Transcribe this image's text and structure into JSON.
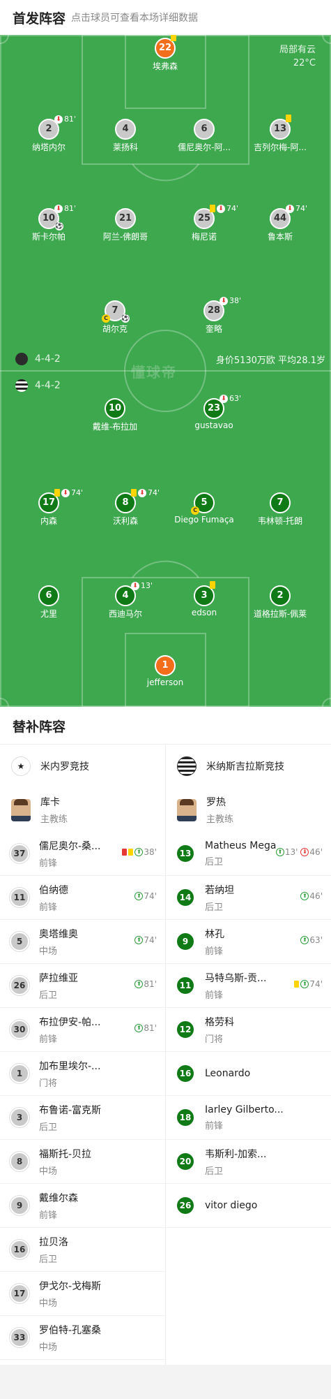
{
  "header": {
    "title": "首发阵容",
    "subtitle": "点击球员可查看本场详细数据"
  },
  "pitch": {
    "weather": [
      "局部有云",
      "22°C"
    ],
    "watermark": "懂球帝",
    "away_formation": "4-4-2",
    "home_formation": "4-4-2",
    "squad_value": "身价5130万欧 平均28.1岁"
  },
  "away_lineup": [
    {
      "num": "22",
      "name": "埃弗森",
      "gk": true,
      "ev": "yc"
    },
    {
      "num": "2",
      "name": "纳塔内尔",
      "ev": "sub",
      "min": "81'"
    },
    {
      "num": "4",
      "name": "莱扬科"
    },
    {
      "num": "6",
      "name": "儒尼奥尔-阿..."
    },
    {
      "num": "13",
      "name": "吉列尔梅-阿...",
      "ev": "yc"
    },
    {
      "num": "10",
      "name": "斯卡尔帕",
      "ev": "sub",
      "min": "81'",
      "ball": true
    },
    {
      "num": "21",
      "name": "阿兰-佛朗哥"
    },
    {
      "num": "25",
      "name": "梅尼诺",
      "ev": "yc-sub",
      "min": "74'"
    },
    {
      "num": "44",
      "name": "鲁本斯",
      "ev": "sub",
      "min": "74'"
    },
    {
      "num": "7",
      "name": "胡尔克",
      "cap": true,
      "ball": true
    },
    {
      "num": "28",
      "name": "奎略",
      "ev": "sub",
      "min": "38'"
    }
  ],
  "home_lineup": [
    {
      "num": "10",
      "name": "戴维-布拉加"
    },
    {
      "num": "23",
      "name": "gustavao",
      "ev": "sub",
      "min": "63'"
    },
    {
      "num": "17",
      "name": "内森",
      "ev": "yc-sub",
      "min": "74'"
    },
    {
      "num": "8",
      "name": "沃利森",
      "ev": "yc-sub",
      "min": "74'"
    },
    {
      "num": "5",
      "name": "Diego Fumaça",
      "cap": true
    },
    {
      "num": "7",
      "name": "韦林顿-托朗"
    },
    {
      "num": "6",
      "name": "尤里"
    },
    {
      "num": "4",
      "name": "西迪马尔",
      "ev": "sub",
      "min": "13'"
    },
    {
      "num": "3",
      "name": "edson",
      "ev": "yc"
    },
    {
      "num": "2",
      "name": "道格拉斯-佩莱"
    },
    {
      "num": "1",
      "name": "jefferson",
      "gk": true
    }
  ],
  "subs": {
    "title": "替补阵容",
    "left": {
      "team": "米内罗竞技",
      "coach": {
        "name": "库卡",
        "role": "主教练"
      },
      "players": [
        {
          "num": "37",
          "name": "儒尼奥尔-桑...",
          "pos": "前锋",
          "card": "ry",
          "in": "38'"
        },
        {
          "num": "11",
          "name": "伯纳德",
          "pos": "前锋",
          "in": "74'"
        },
        {
          "num": "5",
          "name": "奥塔维奥",
          "pos": "中场",
          "in": "74'"
        },
        {
          "num": "26",
          "name": "萨拉维亚",
          "pos": "后卫",
          "in": "81'"
        },
        {
          "num": "30",
          "name": "布拉伊安-帕...",
          "pos": "前锋",
          "in": "81'"
        },
        {
          "num": "1",
          "name": "加布里埃尔-...",
          "pos": "门将"
        },
        {
          "num": "3",
          "name": "布鲁诺-富克斯",
          "pos": "后卫"
        },
        {
          "num": "8",
          "name": "福斯托-贝拉",
          "pos": "中场"
        },
        {
          "num": "9",
          "name": "戴维尔森",
          "pos": "前锋"
        },
        {
          "num": "16",
          "name": "拉贝洛",
          "pos": "后卫"
        },
        {
          "num": "17",
          "name": "伊戈尔-戈梅斯",
          "pos": "中场"
        },
        {
          "num": "33",
          "name": "罗伯特-孔塞桑",
          "pos": "中场"
        }
      ]
    },
    "right": {
      "team": "米纳斯吉拉斯竞技",
      "coach": {
        "name": "罗热",
        "role": "主教练"
      },
      "players": [
        {
          "num": "13",
          "name": "Matheus Mega",
          "pos": "后卫",
          "in": "13'",
          "out": "46'"
        },
        {
          "num": "14",
          "name": "若纳坦",
          "pos": "后卫",
          "in": "46'"
        },
        {
          "num": "9",
          "name": "林孔",
          "pos": "前锋",
          "in": "63'"
        },
        {
          "num": "11",
          "name": "马特乌斯-贡...",
          "pos": "前锋",
          "card": "y",
          "in": "74'"
        },
        {
          "num": "12",
          "name": "格劳科",
          "pos": "门将"
        },
        {
          "num": "16",
          "name": "Leonardo",
          "pos": ""
        },
        {
          "num": "18",
          "name": "Iarley Gilberto...",
          "pos": "前锋"
        },
        {
          "num": "20",
          "name": "韦斯利-加索...",
          "pos": "后卫"
        },
        {
          "num": "26",
          "name": "vitor diego",
          "pos": ""
        }
      ]
    }
  }
}
